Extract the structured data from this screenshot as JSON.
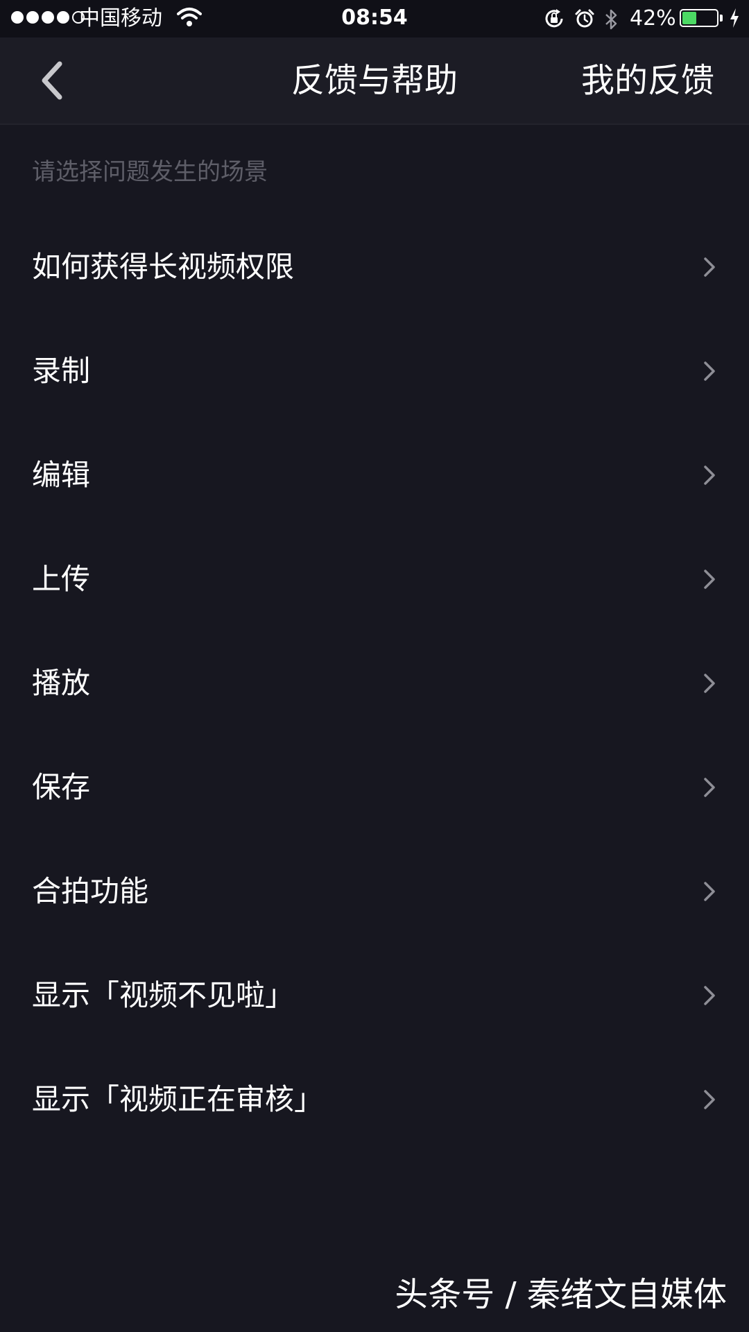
{
  "status_bar": {
    "carrier": "中国移动",
    "time": "08:54",
    "battery_percent": "42%",
    "battery_level": 0.42,
    "icons": [
      "signal-dots",
      "wifi-icon",
      "rotation-lock-icon",
      "alarm-icon",
      "bluetooth-icon",
      "battery-icon",
      "charging-icon"
    ]
  },
  "nav": {
    "back_icon": "chevron-left-icon",
    "title": "反馈与帮助",
    "right_action": "我的反馈"
  },
  "section_hint": "请选择问题发生的场景",
  "items": [
    {
      "label": "如何获得长视频权限"
    },
    {
      "label": "录制"
    },
    {
      "label": "编辑"
    },
    {
      "label": "上传"
    },
    {
      "label": "播放"
    },
    {
      "label": "保存"
    },
    {
      "label": "合拍功能"
    },
    {
      "label": "显示「视频不见啦」"
    },
    {
      "label": "显示「视频正在审核」"
    }
  ],
  "watermark": "头条号 / 秦绪文自媒体",
  "colors": {
    "background": "#171720",
    "nav_background": "#1c1c25",
    "hint_text": "#5e5e68",
    "chevron": "#8e8e96",
    "battery_fill": "#4cd964"
  }
}
